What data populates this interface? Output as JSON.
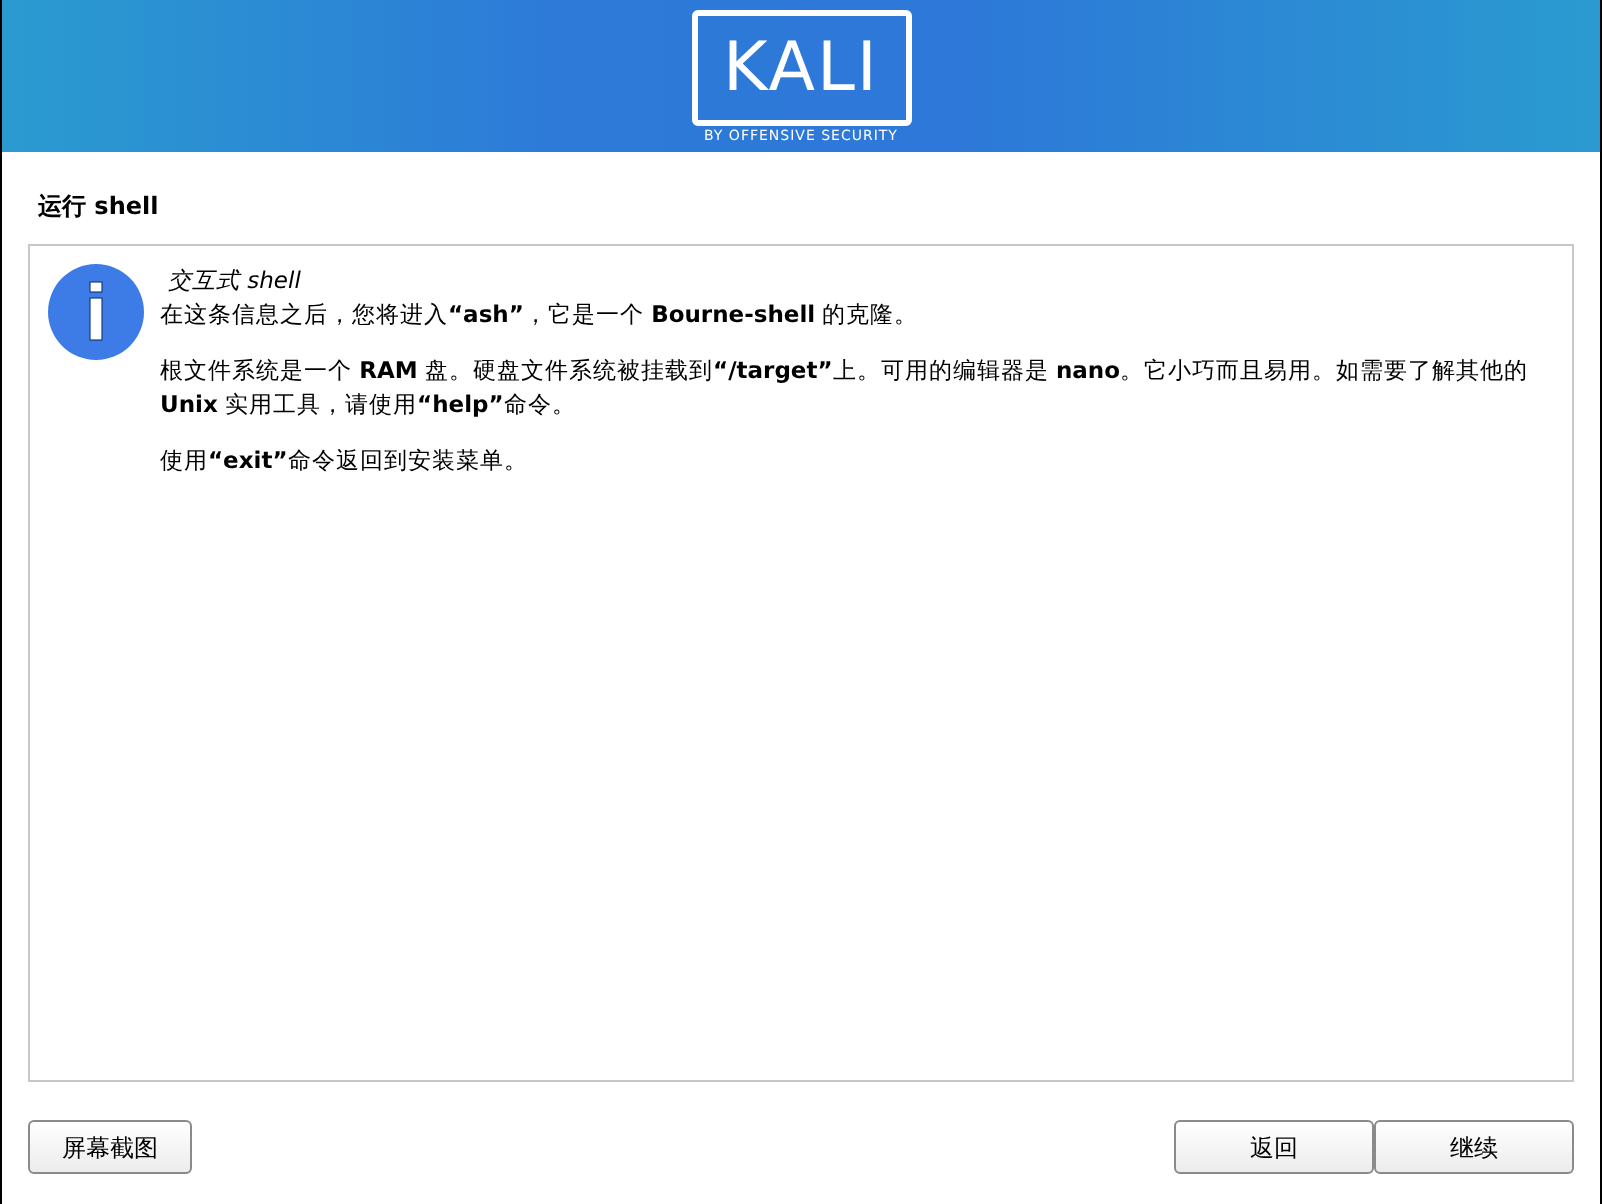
{
  "header": {
    "logo_text": "KALI",
    "logo_tagline": "BY OFFENSIVE SECURITY"
  },
  "page_title": "运行 shell",
  "message": {
    "title": "交互式 shell",
    "paragraphs": [
      "在这条信息之后，您将进入**“ash”**，它是一个 **Bourne-shell** 的克隆。",
      "根文件系统是一个 **RAM** 盘。硬盘文件系统被挂载到**“/target”**上。可用的编辑器是 **nano**。它小巧而且易用。如需要了解其他的 **Unix** 实用工具，请使用**“help”**命令。",
      "使用**“exit”**命令返回到安装菜单。"
    ]
  },
  "buttons": {
    "left": [
      "屏幕截图"
    ],
    "right": [
      "返回",
      "继续"
    ]
  }
}
